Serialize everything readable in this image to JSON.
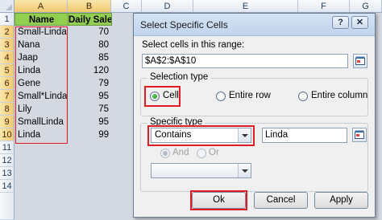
{
  "sheet": {
    "columns": [
      "A",
      "B",
      "C",
      "D",
      "E",
      "F",
      "G"
    ],
    "rows": [
      "1",
      "2",
      "3",
      "4",
      "5",
      "6",
      "7",
      "8",
      "9",
      "10",
      "11",
      "12",
      "13",
      "14"
    ],
    "header": {
      "name": "Name",
      "sale": "Daily Sale"
    },
    "data": [
      {
        "name": "Small-Linda",
        "sale": "70"
      },
      {
        "name": "Nana",
        "sale": "80"
      },
      {
        "name": "Jaap",
        "sale": "85"
      },
      {
        "name": "Linda",
        "sale": "120"
      },
      {
        "name": "Gene",
        "sale": "79"
      },
      {
        "name": "Small*Linda",
        "sale": "95"
      },
      {
        "name": "Lily",
        "sale": "75"
      },
      {
        "name": "SmallLinda",
        "sale": "95"
      },
      {
        "name": "Linda",
        "sale": "99"
      }
    ],
    "header_fill": "#92cf50",
    "highlight_color": "#e01b24"
  },
  "dialog": {
    "title": "Select Specific Cells",
    "help_label": "?",
    "close_label": "✕",
    "range_label": "Select cells in this range:",
    "range_value": "$A$2:$A$10",
    "selection_type": {
      "title": "Selection type",
      "options": [
        "Cell",
        "Entire row",
        "Entire column"
      ],
      "selected": "Cell"
    },
    "specific_type": {
      "title": "Specific type",
      "condition1": "Contains",
      "value1": "Linda",
      "and_label": "And",
      "or_label": "Or",
      "logic_selected": "And",
      "condition2": "",
      "value2": ""
    },
    "buttons": {
      "ok": "Ok",
      "cancel": "Cancel",
      "apply": "Apply"
    }
  }
}
